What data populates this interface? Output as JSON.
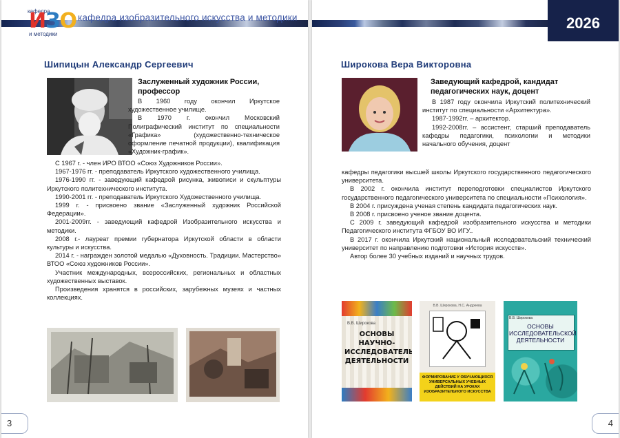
{
  "header": {
    "logo_top": "кафедра",
    "logo_letters": [
      "И",
      "З",
      "О"
    ],
    "logo_bottom": "и методики",
    "title": "кафедра изобразительного искусства и методики",
    "year": "2026"
  },
  "left": {
    "name": "Шипицын Александр Сергеевич",
    "subtitle": "Заслуженный художник России, профессор",
    "bio_top": [
      "В 1960 году окончил Иркутское художественное училище.",
      "В 1970 г. окончил Московский Полиграфический институт по специальности «Графика» (художественно-техническое оформление печатной продукции), квалификация «Художник-график»."
    ],
    "bio": [
      "С 1967 г. - член ИРО ВТОО «Союз Художников России».",
      "1967-1976 гг. - преподаватель Иркутского художественного училища.",
      "1976-1990 гг. - заведующий кафедрой рисунка, живописи и скульптуры Иркутского политехнического института.",
      "1990-2001 гг. - преподаватель Иркутского Художественного училища.",
      "1999 г. - присвоено звание «Заслуженный художник Российской Федерации».",
      "2001-2009гг. - заведующий кафедрой Изобразительного искусства и методики.",
      "2008 г.- лауреат премии губернатора Иркутской области в области культуры и искусства.",
      "2014 г. - награжден золотой медалью «Духовность. Традиции. Мастерство» ВТОО «Союз художников России».",
      "Участник международных, всероссийских, региональных и областных художественных выставок.",
      "Произведения хранятся в российских, зарубежных музеях и частных коллекциях."
    ],
    "page_number": "3"
  },
  "right": {
    "name": "Широкова Вера Викторовна",
    "subtitle": "Заведующий кафедрой, кандидат педагогических наук, доцент",
    "bio_top": [
      "В 1987 году окончила Иркутский политехнический институт по специальности «Архитектура».",
      "1987-1992гг. – архитектор.",
      "1992-2008гг. – ассистент, старший преподаватель кафедры педагогики, психологии и методики начального обучения, доцент"
    ],
    "bio_cont": "кафедры педагогики высшей школы Иркутского государственного педагогического университета.",
    "bio": [
      "В 2002 г. окончила институт переподготовки специалистов Иркутского государственного педагогического университета по специальности «Психология».",
      "В 2004 г. присуждена ученая степень кандидата педагогических наук.",
      "В 2008 г. присвоено ученое звание доцента.",
      "С 2009 г. заведующий кафедрой изобразительного искусства и методики Педагогического института ФГБОУ ВО ИГУ..",
      "В 2017 г. окончила Иркутский национальный исследовательский технический университет по направлению подготовки «История искусств».",
      "Автор более 30 учебных изданий и научных трудов."
    ],
    "books": [
      {
        "author": "В.В. Широкова",
        "title": "ОСНОВЫ НАУЧНО-ИССЛЕДОВАТЕЛЬСКОЙ ДЕЯТЕЛЬНОСТИ"
      },
      {
        "author": "В.В. Широкова, Н.С. Андреева",
        "title": "ФОРМИРОВАНИЕ У ОБУЧАЮЩИХСЯ УНИВЕРСАЛЬНЫХ УЧЕБНЫХ ДЕЙСТВИЙ НА УРОКАХ ИЗОБРАЗИТЕЛЬНОГО ИСКУССТВА"
      },
      {
        "author": "В.В. Широкова",
        "title": "ОСНОВЫ ИССЛЕДОВАТЕЛЬСКОЙ ДЕЯТЕЛЬНОСТИ"
      }
    ],
    "page_number": "4"
  }
}
